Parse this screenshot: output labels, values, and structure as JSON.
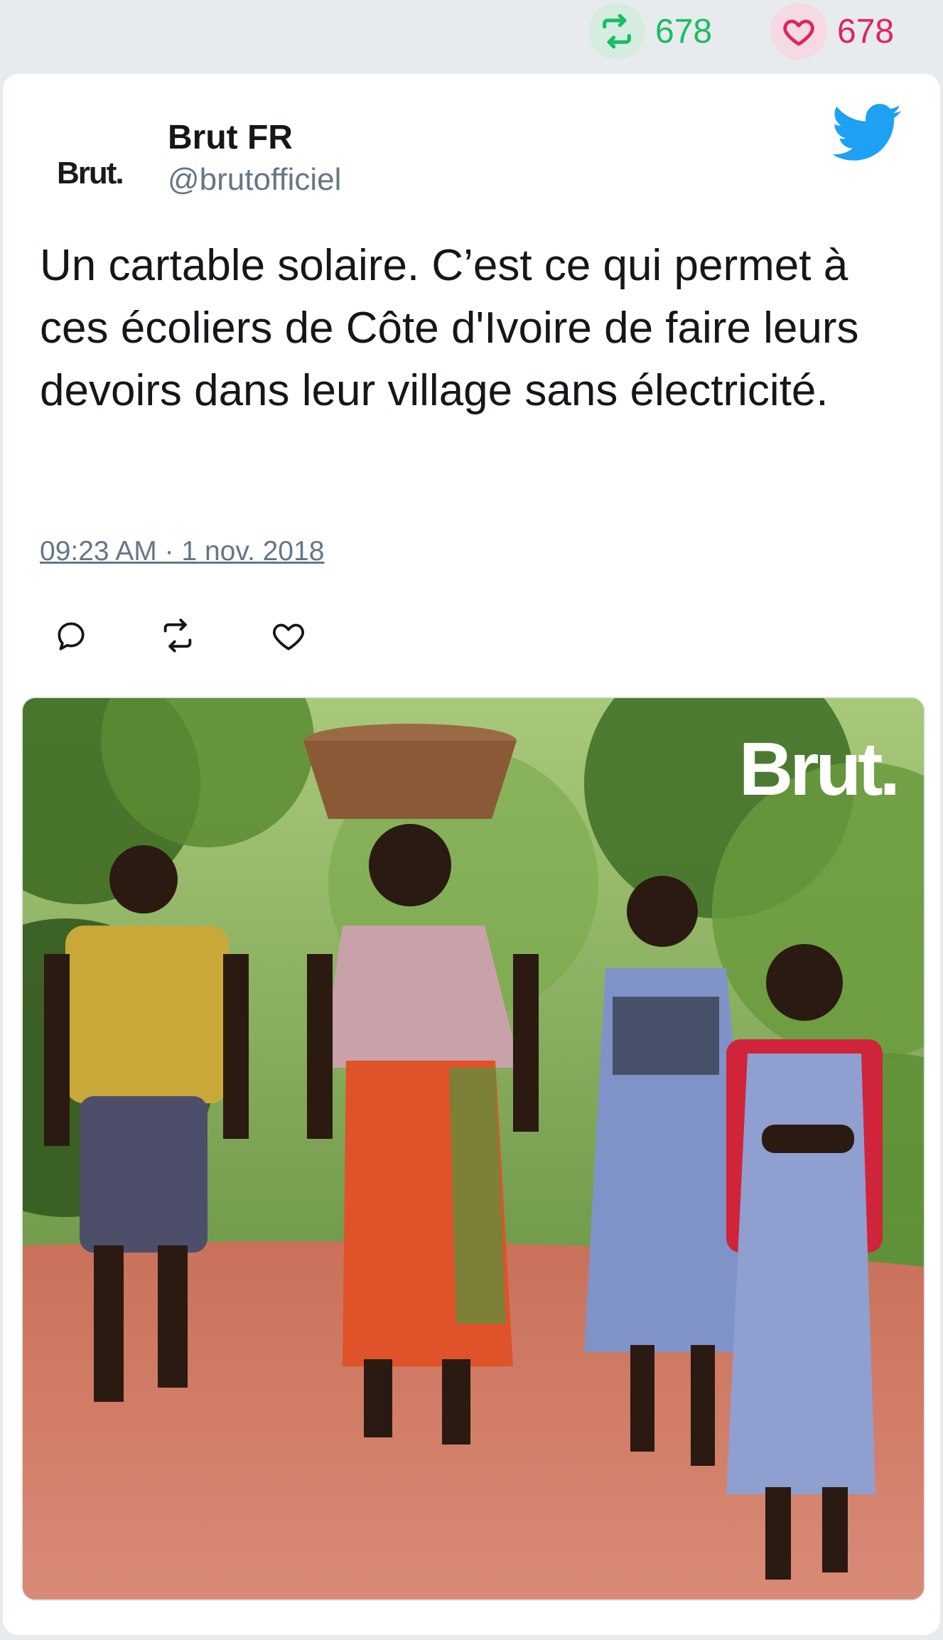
{
  "header_stats": {
    "retweet_count": "678",
    "like_count": "678",
    "retweet_color": "#17bf63",
    "like_color": "#e0245e"
  },
  "tweet": {
    "avatar_text": "Brut.",
    "display_name": "Brut FR",
    "handle": "@brutofficiel",
    "text": "Un cartable solaire. C’est ce qui permet à ces écoliers de Côte d'Ivoire de faire leurs devoirs dans leur village sans électricité.",
    "timestamp": "09:23 AM · 1 nov. 2018",
    "brand_icon": "twitter-bird-icon",
    "brand_color": "#1da1f2"
  },
  "actions": [
    {
      "icon": "reply-icon"
    },
    {
      "icon": "retweet-icon"
    },
    {
      "icon": "heart-icon"
    }
  ],
  "media": {
    "watermark": "Brut."
  }
}
